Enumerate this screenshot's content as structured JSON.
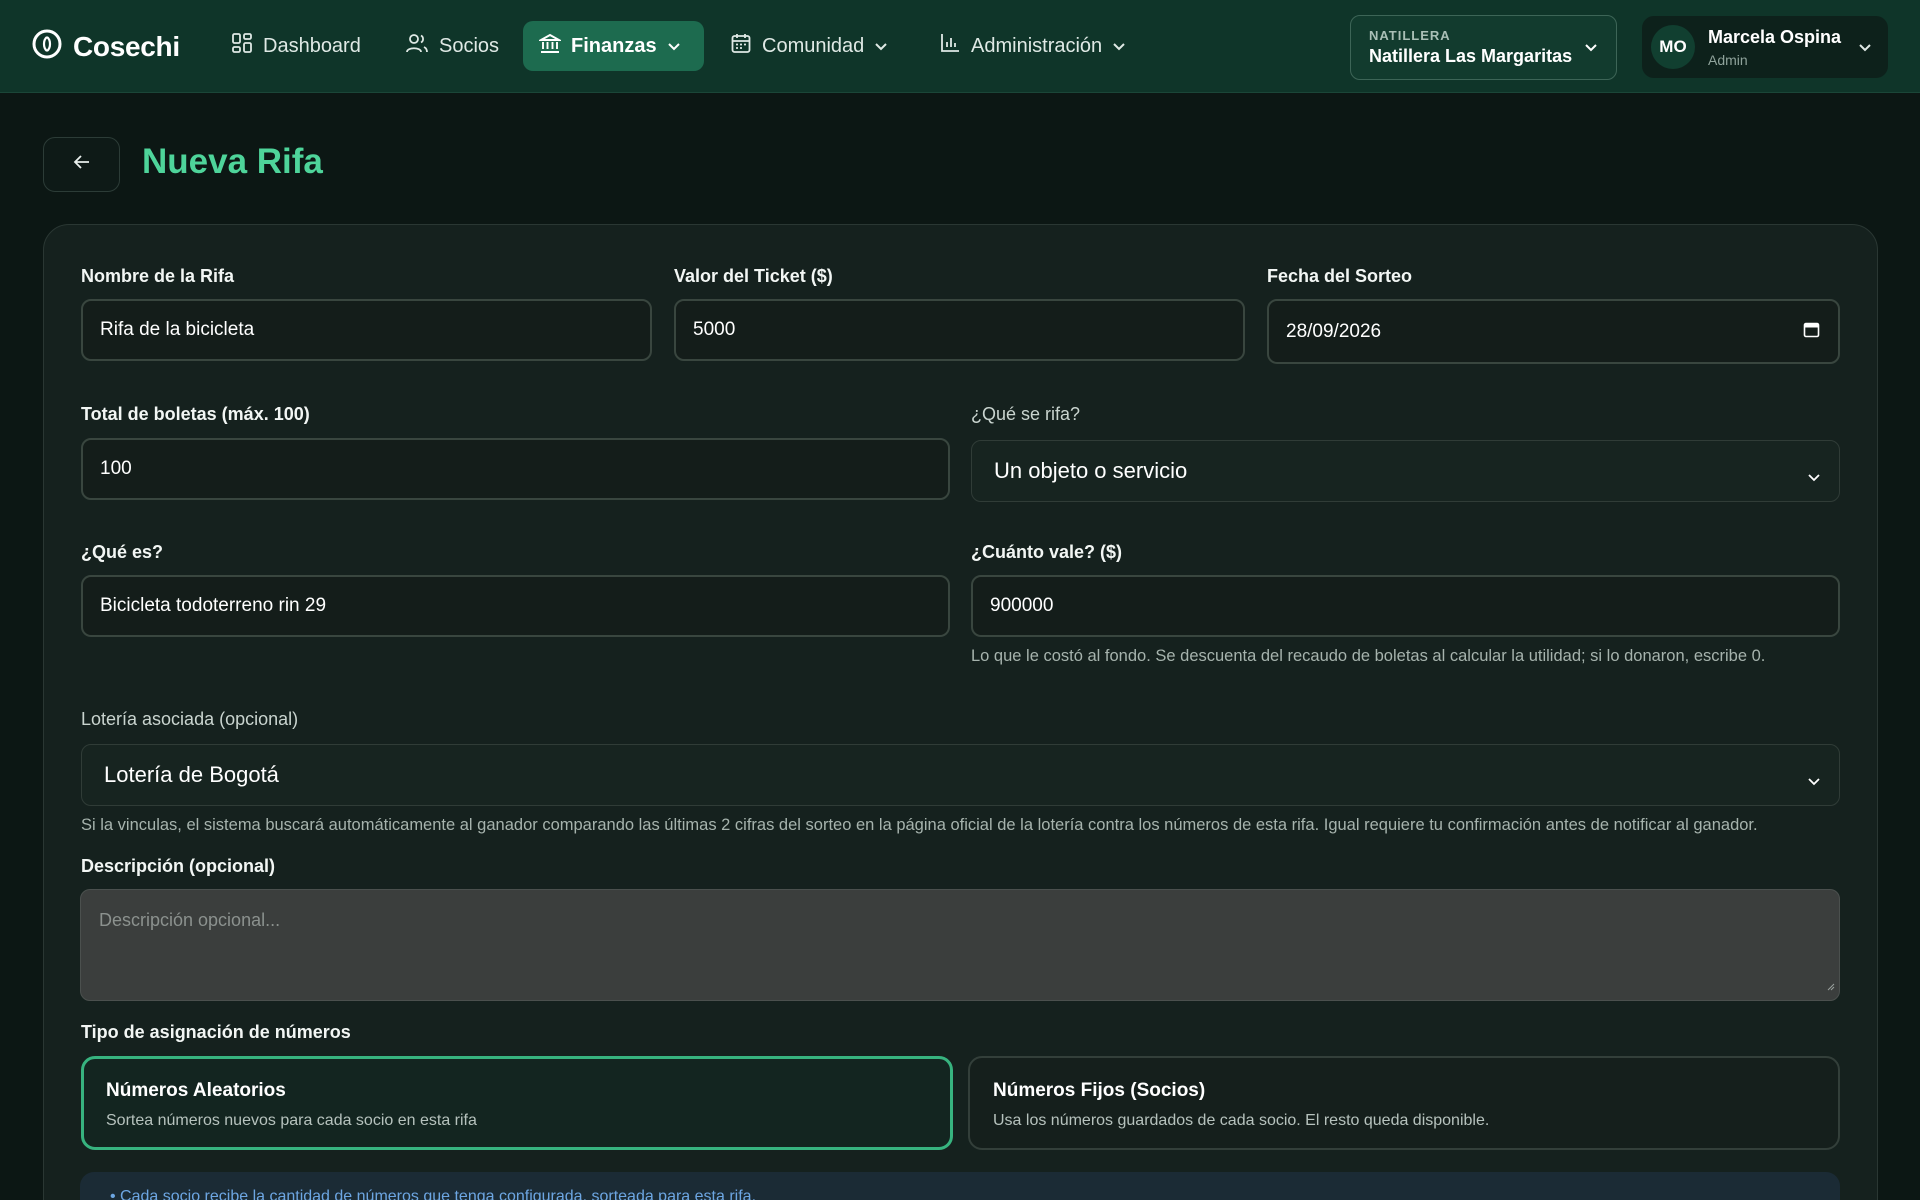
{
  "brand": {
    "name": "Cosechi"
  },
  "nav": {
    "items": [
      {
        "label": "Dashboard"
      },
      {
        "label": "Socios"
      },
      {
        "label": "Finanzas"
      },
      {
        "label": "Comunidad"
      },
      {
        "label": "Administración"
      }
    ],
    "active": "Finanzas"
  },
  "org": {
    "label": "NATILLERA",
    "name": "Natillera Las Margaritas"
  },
  "user": {
    "initials": "MO",
    "name": "Marcela Ospina",
    "role": "Admin"
  },
  "page": {
    "title": "Nueva Rifa"
  },
  "form": {
    "nombre": {
      "label": "Nombre de la Rifa",
      "value": "Rifa de la bicicleta"
    },
    "valor": {
      "label": "Valor del Ticket ($)",
      "value": "5000"
    },
    "fecha": {
      "label": "Fecha del Sorteo",
      "value": "28/09/2026"
    },
    "total": {
      "label": "Total de boletas (máx. 100)",
      "value": "100"
    },
    "que_rifa": {
      "label": "¿Qué se rifa?",
      "value": "Un objeto o servicio"
    },
    "que_es": {
      "label": "¿Qué es?",
      "value": "Bicicleta todoterreno rin 29"
    },
    "cuanto": {
      "label": "¿Cuánto vale? ($)",
      "value": "900000",
      "hint": "Lo que le costó al fondo. Se descuenta del recaudo de boletas al calcular la utilidad; si lo donaron, escribe 0."
    },
    "loteria": {
      "label": "Lotería asociada (opcional)",
      "value": "Lotería de Bogotá",
      "hint": "Si la vinculas, el sistema buscará automáticamente al ganador comparando las últimas 2 cifras del sorteo en la página oficial de la lotería contra los números de esta rifa. Igual requiere tu confirmación antes de notificar al ganador."
    },
    "descripcion": {
      "label": "Descripción (opcional)",
      "placeholder": "Descripción opcional..."
    },
    "tipo": {
      "label": "Tipo de asignación de números",
      "options": [
        {
          "title": "Números Aleatorios",
          "desc": "Sortea números nuevos para cada socio en esta rifa",
          "selected": true
        },
        {
          "title": "Números Fijos (Socios)",
          "desc": "Usa los números guardados de cada socio. El resto queda disponible.",
          "selected": false
        }
      ]
    },
    "info": "• Cada socio recibe la cantidad de números que tenga configurada, sorteada para esta rifa."
  },
  "colors": {
    "accent": "#4ed49a",
    "nav_bg": "#0f3529",
    "active_nav": "#1d6b4f",
    "page_bg": "#0c1714"
  }
}
